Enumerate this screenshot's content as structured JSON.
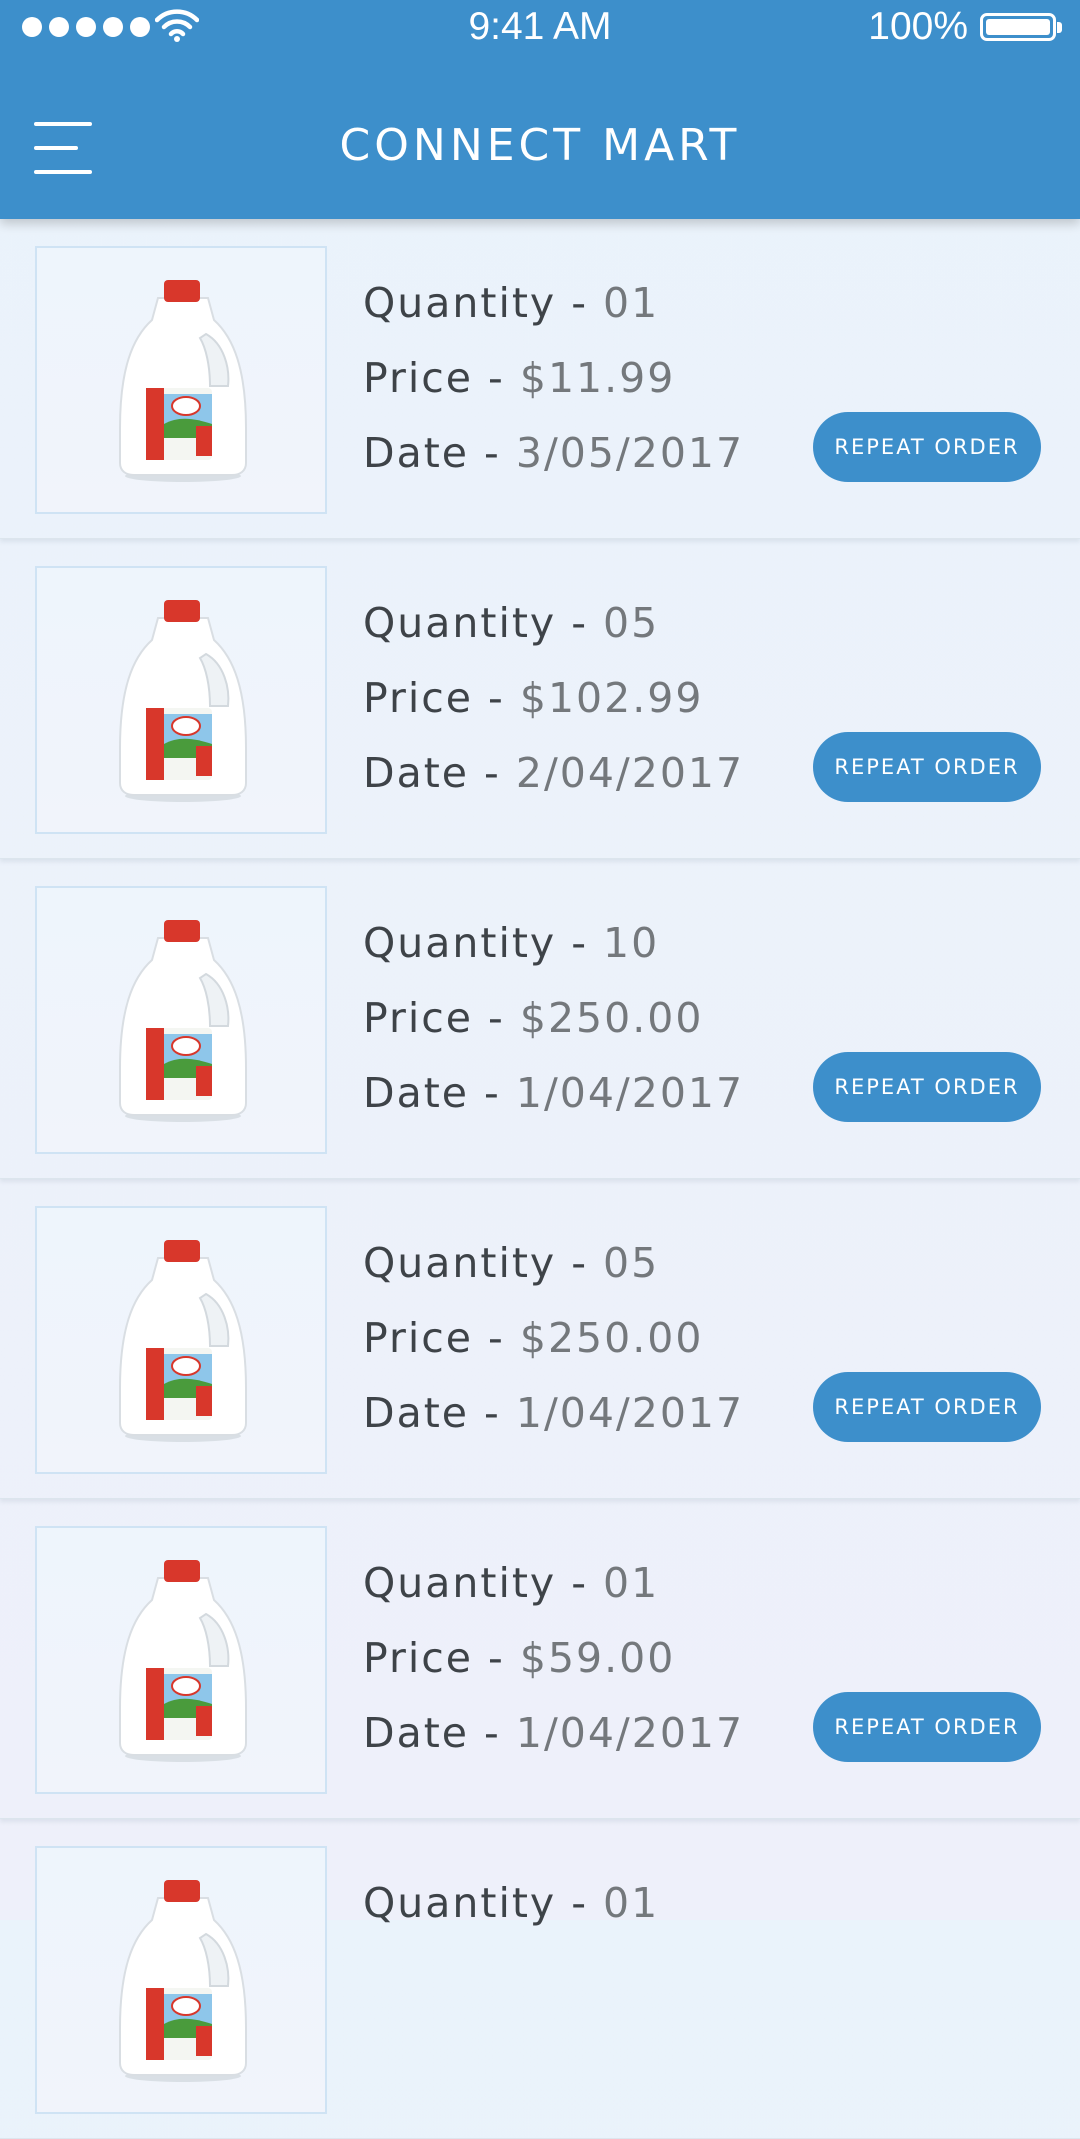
{
  "status_bar": {
    "time": "9:41 AM",
    "battery": "100%",
    "signal_icon": "signal-dots-icon",
    "wifi_icon": "wifi-icon",
    "battery_icon": "battery-icon"
  },
  "header": {
    "title": "CONNECT MART",
    "menu_icon": "hamburger-menu-icon",
    "color": "#3d8fcb"
  },
  "orders": [
    {
      "qty_label": "Quantity - ",
      "qty": "01",
      "price_label": "Price - ",
      "price": "$11.99",
      "date_label": "Date - ",
      "date": "3/05/2017",
      "button": "REPEAT ORDER"
    },
    {
      "qty_label": "Quantity - ",
      "qty": "05",
      "price_label": "Price - ",
      "price": "$102.99",
      "date_label": "Date - ",
      "date": "2/04/2017",
      "button": "REPEAT ORDER"
    },
    {
      "qty_label": "Quantity - ",
      "qty": "10",
      "price_label": "Price - ",
      "price": "$250.00",
      "date_label": "Date - ",
      "date": "1/04/2017",
      "button": "REPEAT ORDER"
    },
    {
      "qty_label": "Quantity - ",
      "qty": "05",
      "price_label": "Price - ",
      "price": "$250.00",
      "date_label": "Date - ",
      "date": "1/04/2017",
      "button": "REPEAT ORDER"
    },
    {
      "qty_label": "Quantity - ",
      "qty": "01",
      "price_label": "Price - ",
      "price": "$59.00",
      "date_label": "Date - ",
      "date": "1/04/2017",
      "button": "REPEAT ORDER"
    },
    {
      "qty_label": "Quantity - ",
      "qty": "01",
      "price_label": "",
      "price": "",
      "date_label": "",
      "date": "",
      "button": ""
    }
  ]
}
